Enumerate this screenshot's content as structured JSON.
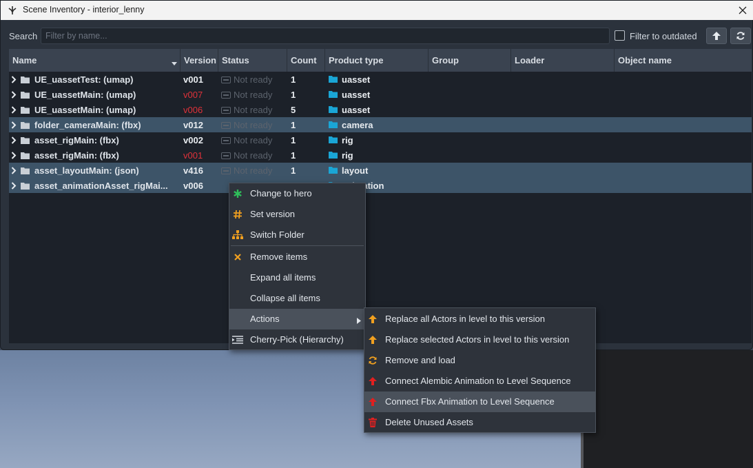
{
  "window": {
    "title": "Scene Inventory - interior_lenny"
  },
  "toolbar": {
    "search_label": "Search",
    "search_placeholder": "Filter by name...",
    "search_value": "",
    "filter_outdated_label": "Filter to outdated",
    "filter_outdated_checked": false,
    "up_icon": "arrow-up-icon",
    "refresh_icon": "refresh-icon"
  },
  "columns": {
    "name": "Name",
    "version": "Version",
    "status": "Status",
    "count": "Count",
    "product_type": "Product type",
    "group": "Group",
    "loader": "Loader",
    "object_name": "Object name"
  },
  "rows": [
    {
      "name": "UE_uassetTest: (umap)",
      "version": "v001",
      "outdated": false,
      "status": "Not ready",
      "count": "1",
      "product_type": "uasset",
      "selected": false
    },
    {
      "name": "UE_uassetMain: (umap)",
      "version": "v007",
      "outdated": true,
      "status": "Not ready",
      "count": "1",
      "product_type": "uasset",
      "selected": false
    },
    {
      "name": "UE_uassetMain: (umap)",
      "version": "v006",
      "outdated": true,
      "status": "Not ready",
      "count": "5",
      "product_type": "uasset",
      "selected": false
    },
    {
      "name": "folder_cameraMain: (fbx)",
      "version": "v012",
      "outdated": false,
      "status": "Not ready",
      "count": "1",
      "product_type": "camera",
      "selected": true
    },
    {
      "name": "asset_rigMain: (fbx)",
      "version": "v002",
      "outdated": false,
      "status": "Not ready",
      "count": "1",
      "product_type": "rig",
      "selected": false
    },
    {
      "name": "asset_rigMain: (fbx)",
      "version": "v001",
      "outdated": true,
      "status": "Not ready",
      "count": "1",
      "product_type": "rig",
      "selected": false
    },
    {
      "name": "asset_layoutMain: (json)",
      "version": "v416",
      "outdated": false,
      "status": "Not ready",
      "count": "1",
      "product_type": "layout",
      "selected": true
    },
    {
      "name": "asset_animationAsset_rigMai...",
      "version": "v006",
      "outdated": false,
      "status": "",
      "count": "",
      "product_type": "animation",
      "selected": true
    }
  ],
  "context_menu": {
    "items": [
      {
        "label": "Change to hero",
        "icon": "asterisk-icon",
        "color": "#2fbf5a"
      },
      {
        "label": "Set version",
        "icon": "hash-icon",
        "color": "#f0a020"
      },
      {
        "label": "Switch Folder",
        "icon": "sitemap-icon",
        "color": "#f0a020"
      },
      {
        "label": "Remove items",
        "icon": "x-icon",
        "color": "#f0a020"
      },
      {
        "label": "Expand all items",
        "icon": "",
        "color": ""
      },
      {
        "label": "Collapse all items",
        "icon": "",
        "color": ""
      },
      {
        "label": "Actions",
        "icon": "",
        "color": "",
        "highlighted": true
      },
      {
        "label": "Cherry-Pick (Hierarchy)",
        "icon": "indent-icon",
        "color": "#d8dde3"
      }
    ]
  },
  "actions_submenu": {
    "items": [
      {
        "label": "Replace all Actors in level to this version",
        "icon": "arrow-up-icon",
        "color": "#f0a020"
      },
      {
        "label": "Replace selected Actors in level to this version",
        "icon": "arrow-up-icon",
        "color": "#f0a020"
      },
      {
        "label": "Remove and load",
        "icon": "refresh-icon",
        "color": "#f0a020"
      },
      {
        "label": "Connect Alembic Animation to Level Sequence",
        "icon": "arrow-up-icon",
        "color": "#e02020"
      },
      {
        "label": "Connect Fbx Animation to Level Sequence",
        "icon": "arrow-up-icon",
        "color": "#e02020",
        "highlighted": true
      },
      {
        "label": "Delete Unused Assets",
        "icon": "trash-icon",
        "color": "#e02020"
      }
    ]
  },
  "colors": {
    "product_type_folder": "#1aa6d6",
    "selection": "#3d5468",
    "outdated_version": "#e0323a"
  }
}
